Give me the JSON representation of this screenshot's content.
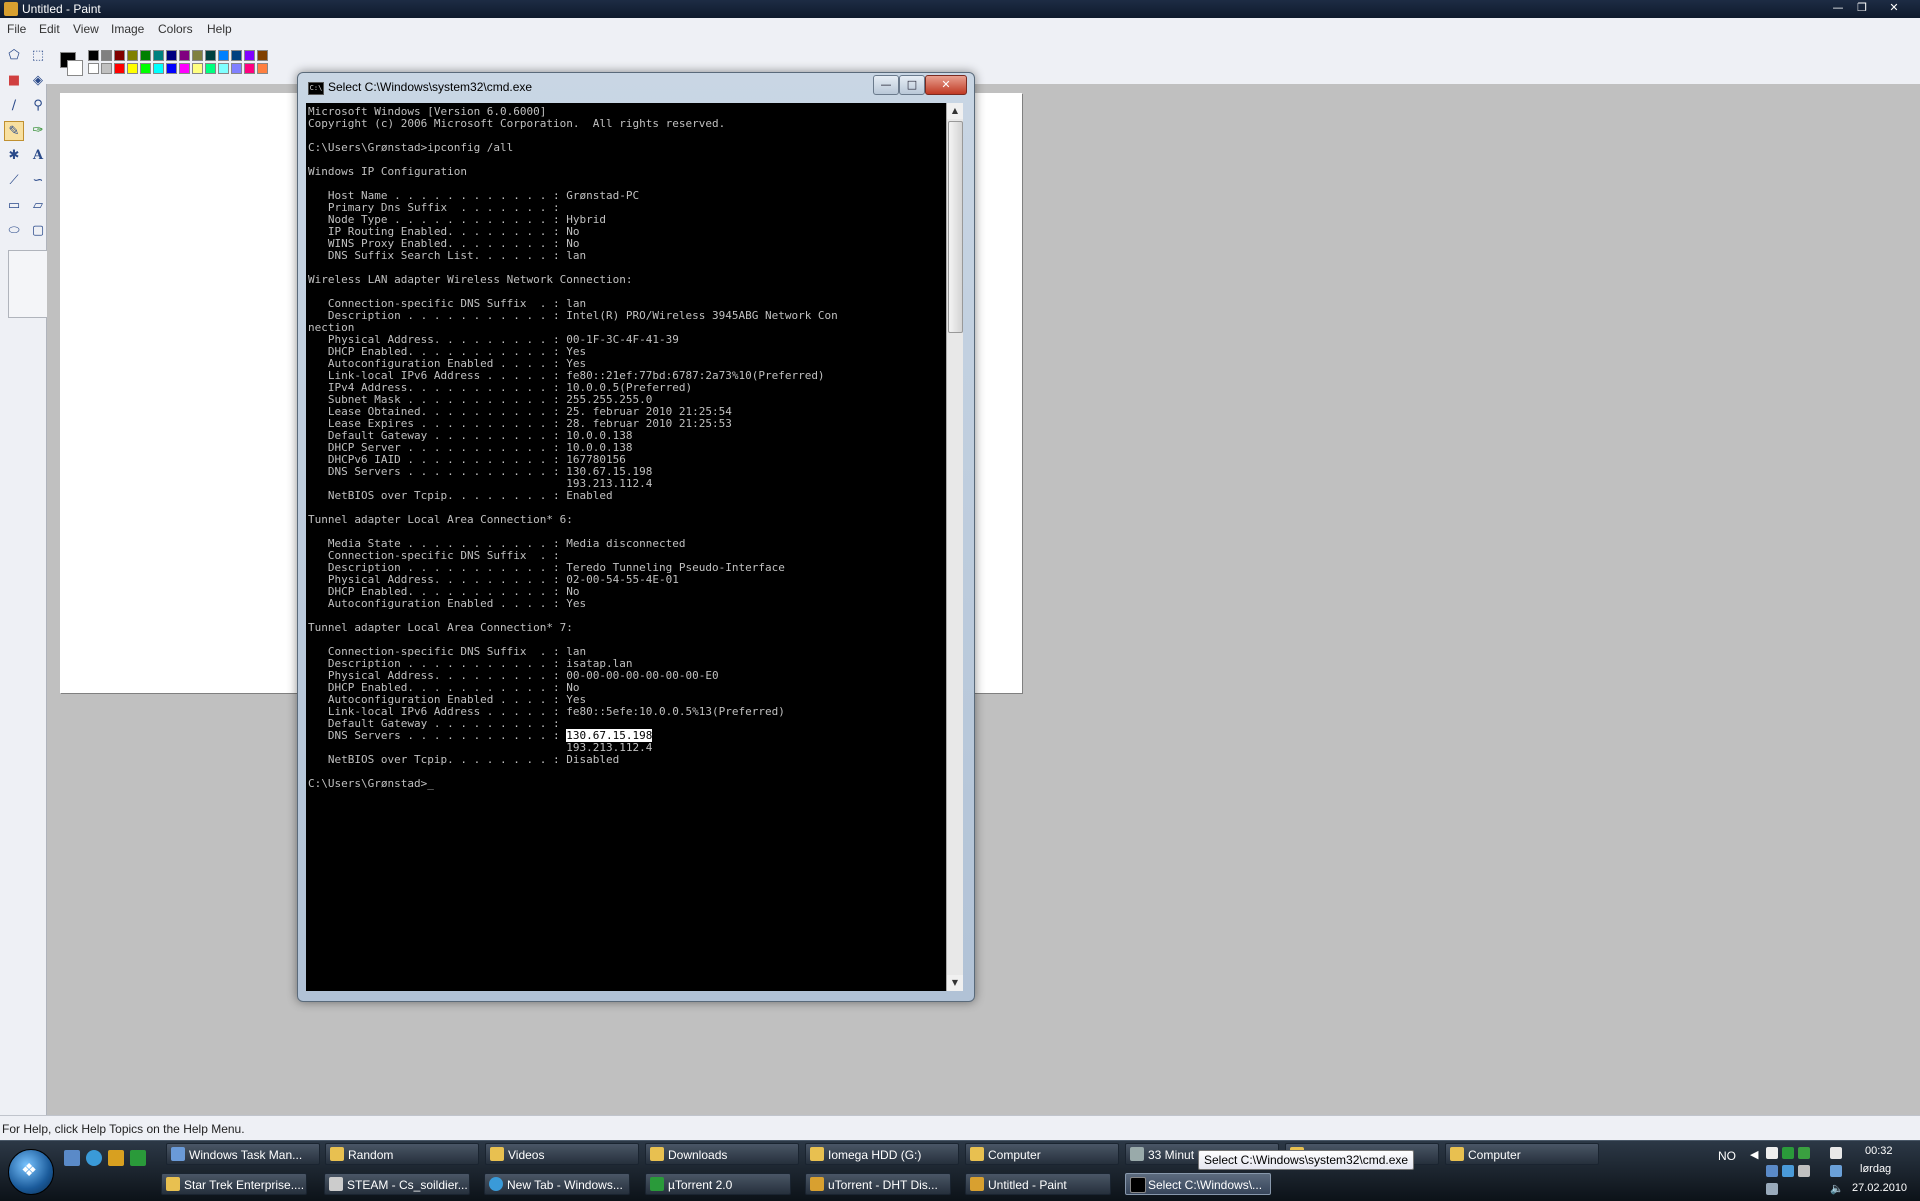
{
  "paint": {
    "title": "Untitled - Paint",
    "menu": [
      "File",
      "Edit",
      "View",
      "Image",
      "Colors",
      "Help"
    ],
    "status": "For Help, click Help Topics on the Help Menu."
  },
  "cmd": {
    "title": "Select C:\\Windows\\system32\\cmd.exe",
    "lines": [
      "Microsoft Windows [Version 6.0.6000]",
      "Copyright (c) 2006 Microsoft Corporation.  All rights reserved.",
      "",
      "C:\\Users\\Grønstad>ipconfig /all",
      "",
      "Windows IP Configuration",
      "",
      "   Host Name . . . . . . . . . . . . : Grønstad-PC",
      "   Primary Dns Suffix  . . . . . . . :",
      "   Node Type . . . . . . . . . . . . : Hybrid",
      "   IP Routing Enabled. . . . . . . . : No",
      "   WINS Proxy Enabled. . . . . . . . : No",
      "   DNS Suffix Search List. . . . . . : lan",
      "",
      "Wireless LAN adapter Wireless Network Connection:",
      "",
      "   Connection-specific DNS Suffix  . : lan",
      "   Description . . . . . . . . . . . : Intel(R) PRO/Wireless 3945ABG Network Con",
      "nection",
      "   Physical Address. . . . . . . . . : 00-1F-3C-4F-41-39",
      "   DHCP Enabled. . . . . . . . . . . : Yes",
      "   Autoconfiguration Enabled . . . . : Yes",
      "   Link-local IPv6 Address . . . . . : fe80::21ef:77bd:6787:2a73%10(Preferred)",
      "   IPv4 Address. . . . . . . . . . . : 10.0.0.5(Preferred)",
      "   Subnet Mask . . . . . . . . . . . : 255.255.255.0",
      "   Lease Obtained. . . . . . . . . . : 25. februar 2010 21:25:54",
      "   Lease Expires . . . . . . . . . . : 28. februar 2010 21:25:53",
      "   Default Gateway . . . . . . . . . : 10.0.0.138",
      "   DHCP Server . . . . . . . . . . . : 10.0.0.138",
      "   DHCPv6 IAID . . . . . . . . . . . : 167780156",
      "   DNS Servers . . . . . . . . . . . : 130.67.15.198",
      "                                       193.213.112.4",
      "   NetBIOS over Tcpip. . . . . . . . : Enabled",
      "",
      "Tunnel adapter Local Area Connection* 6:",
      "",
      "   Media State . . . . . . . . . . . : Media disconnected",
      "   Connection-specific DNS Suffix  . :",
      "   Description . . . . . . . . . . . : Teredo Tunneling Pseudo-Interface",
      "   Physical Address. . . . . . . . . : 02-00-54-55-4E-01",
      "   DHCP Enabled. . . . . . . . . . . : No",
      "   Autoconfiguration Enabled . . . . : Yes",
      "",
      "Tunnel adapter Local Area Connection* 7:",
      "",
      "   Connection-specific DNS Suffix  . : lan",
      "   Description . . . . . . . . . . . : isatap.lan",
      "   Physical Address. . . . . . . . . : 00-00-00-00-00-00-00-E0",
      "   DHCP Enabled. . . . . . . . . . . : No",
      "   Autoconfiguration Enabled . . . . : Yes",
      "   Link-local IPv6 Address . . . . . : fe80::5efe:10.0.0.5%13(Preferred)",
      "   Default Gateway . . . . . . . . . :",
      "   DNS Servers . . . . . . . . . . . : ",
      "                                       193.213.112.4",
      "   NetBIOS over Tcpip. . . . . . . . : Disabled",
      "",
      "C:\\Users\\Grønstad>_"
    ],
    "selection": "130.67.15.198"
  },
  "palette": [
    "#000000",
    "#808080",
    "#800000",
    "#808000",
    "#008000",
    "#008080",
    "#000080",
    "#800080",
    "#808040",
    "#004040",
    "#0080ff",
    "#004080",
    "#8000ff",
    "#804000",
    "#ffffff",
    "#c0c0c0",
    "#ff0000",
    "#ffff00",
    "#00ff00",
    "#00ffff",
    "#0000ff",
    "#ff00ff",
    "#ffff80",
    "#00ff80",
    "#80ffff",
    "#8080ff",
    "#ff0080",
    "#ff8040"
  ],
  "taskbar": {
    "row1": [
      "Windows Task Man...",
      "Random",
      "Videos",
      "Downloads",
      "Iomega HDD (G:)",
      "Computer",
      "33 Minut",
      "",
      "Computer"
    ],
    "row2": [
      "Star Trek Enterprise....",
      "STEAM - Cs_soildier...",
      "New Tab - Windows...",
      "µTorrent 2.0",
      "uTorrent - DHT Dis...",
      "Untitled - Paint",
      "Select C:\\Windows\\..."
    ],
    "language": "NO",
    "time": "00:32",
    "day": "lørdag",
    "date": "27.02.2010",
    "tooltip": "Select C:\\Windows\\system32\\cmd.exe"
  }
}
